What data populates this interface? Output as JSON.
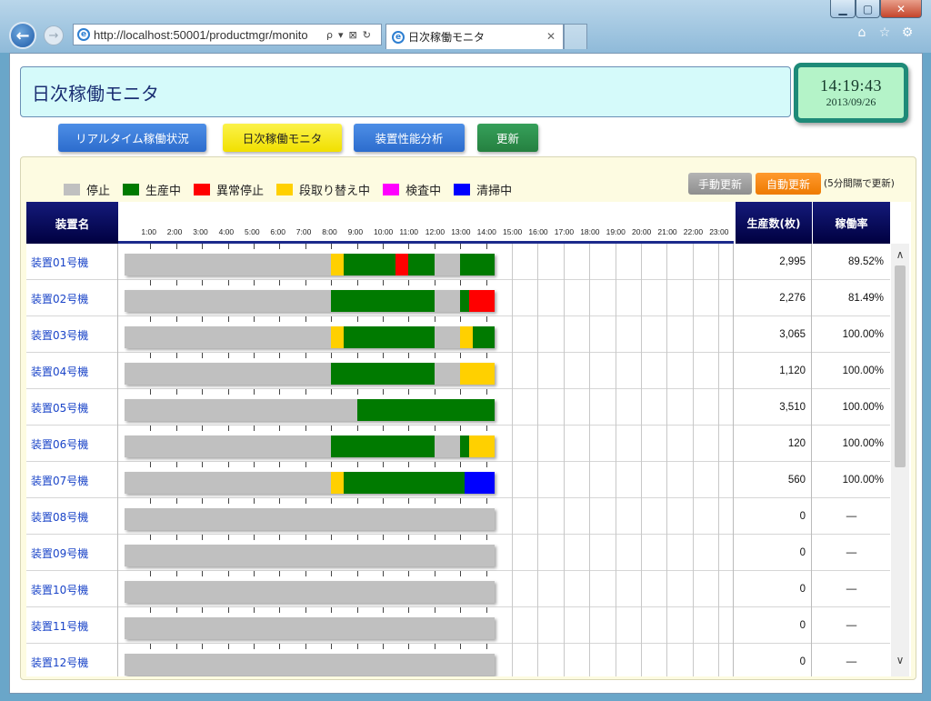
{
  "browser": {
    "url": "http://localhost:50001/productmgr/monito",
    "tab_title": "日次稼働モニタ",
    "search_glyph": "ρ",
    "addr_tools": [
      "▾",
      "⊠",
      "↻"
    ]
  },
  "header": {
    "title": "日次稼働モニタ",
    "clock_time": "14:19:43",
    "clock_date": "2013/09/26"
  },
  "nav": {
    "realtime": "リアルタイム稼働状況",
    "daily": "日次稼働モニタ",
    "performance": "装置性能分析",
    "refresh": "更新"
  },
  "legend": [
    {
      "label": "停止",
      "color": "#c0c0c0"
    },
    {
      "label": "生産中",
      "color": "#007a00"
    },
    {
      "label": "異常停止",
      "color": "#ff0000"
    },
    {
      "label": "段取り替え中",
      "color": "#ffd000"
    },
    {
      "label": "検査中",
      "color": "#ff00ff"
    },
    {
      "label": "清掃中",
      "color": "#0000ff"
    }
  ],
  "update": {
    "manual": "手動更新",
    "auto": "自動更新",
    "note": "(5分間隔で更新)"
  },
  "table": {
    "col_name": "装置名",
    "col_count": "生産数(枚)",
    "col_rate": "稼働率",
    "hours": [
      "1:00",
      "2:00",
      "3:00",
      "4:00",
      "5:00",
      "6:00",
      "7:00",
      "8:00",
      "9:00",
      "10:00",
      "11:00",
      "12:00",
      "13:00",
      "14:00",
      "15:00",
      "16:00",
      "17:00",
      "18:00",
      "19:00",
      "20:00",
      "21:00",
      "22:00",
      "23:00"
    ],
    "current_time_hours": 14.33,
    "rows": [
      {
        "name": "装置01号機",
        "count": "2,995",
        "rate": "89.52%",
        "segments": [
          [
            8.0,
            8.5,
            "setup"
          ],
          [
            8.5,
            10.5,
            "producing"
          ],
          [
            10.5,
            11.0,
            "fault"
          ],
          [
            11.0,
            12.0,
            "producing"
          ],
          [
            12.0,
            13.0,
            "stopped"
          ],
          [
            13.0,
            14.33,
            "producing"
          ]
        ]
      },
      {
        "name": "装置02号機",
        "count": "2,276",
        "rate": "81.49%",
        "segments": [
          [
            8.0,
            12.0,
            "producing"
          ],
          [
            12.0,
            13.0,
            "stopped"
          ],
          [
            13.0,
            13.33,
            "producing"
          ],
          [
            13.33,
            14.33,
            "fault"
          ]
        ]
      },
      {
        "name": "装置03号機",
        "count": "3,065",
        "rate": "100.00%",
        "segments": [
          [
            8.0,
            8.5,
            "setup"
          ],
          [
            8.5,
            12.0,
            "producing"
          ],
          [
            12.0,
            13.0,
            "stopped"
          ],
          [
            13.0,
            13.5,
            "setup"
          ],
          [
            13.5,
            14.33,
            "producing"
          ]
        ]
      },
      {
        "name": "装置04号機",
        "count": "1,120",
        "rate": "100.00%",
        "segments": [
          [
            8.0,
            12.0,
            "producing"
          ],
          [
            12.0,
            13.0,
            "stopped"
          ],
          [
            13.0,
            14.33,
            "setup"
          ]
        ]
      },
      {
        "name": "装置05号機",
        "count": "3,510",
        "rate": "100.00%",
        "segments": [
          [
            9.0,
            14.33,
            "producing"
          ]
        ]
      },
      {
        "name": "装置06号機",
        "count": "120",
        "rate": "100.00%",
        "segments": [
          [
            8.0,
            12.0,
            "producing"
          ],
          [
            12.0,
            13.0,
            "stopped"
          ],
          [
            13.0,
            13.33,
            "producing"
          ],
          [
            13.33,
            14.33,
            "setup"
          ]
        ]
      },
      {
        "name": "装置07号機",
        "count": "560",
        "rate": "100.00%",
        "segments": [
          [
            8.0,
            8.5,
            "setup"
          ],
          [
            8.5,
            13.17,
            "producing"
          ],
          [
            13.17,
            14.33,
            "cleaning"
          ]
        ]
      },
      {
        "name": "装置08号機",
        "count": "0",
        "rate": "—",
        "segments": []
      },
      {
        "name": "装置09号機",
        "count": "0",
        "rate": "—",
        "segments": []
      },
      {
        "name": "装置10号機",
        "count": "0",
        "rate": "—",
        "segments": []
      },
      {
        "name": "装置11号機",
        "count": "0",
        "rate": "—",
        "segments": []
      },
      {
        "name": "装置12号機",
        "count": "0",
        "rate": "—",
        "segments": []
      }
    ]
  },
  "status_colors": {
    "stopped": "#c0c0c0",
    "producing": "#007a00",
    "fault": "#ff0000",
    "setup": "#ffd000",
    "inspecting": "#ff00ff",
    "cleaning": "#0000ff"
  }
}
